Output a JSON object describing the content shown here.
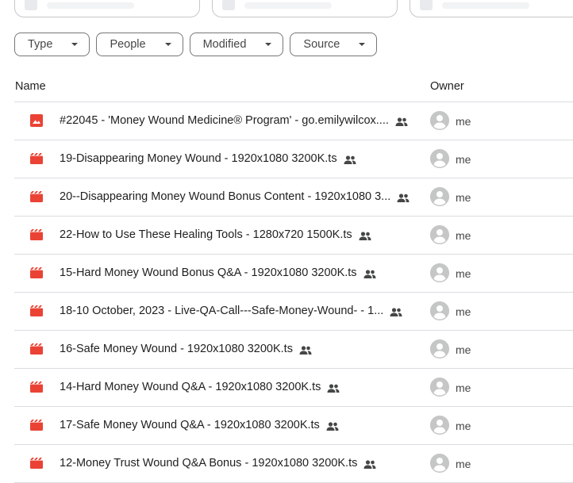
{
  "filters": [
    {
      "label": "Type"
    },
    {
      "label": "People"
    },
    {
      "label": "Modified"
    },
    {
      "label": "Source"
    }
  ],
  "columns": {
    "name": "Name",
    "owner": "Owner"
  },
  "colors": {
    "video_icon": "#ea4335",
    "image_icon": "#ea4335",
    "avatar": "#c4c7c5"
  },
  "files": [
    {
      "name": "#22045 - 'Money Wound Medicine® Program' - go.emilywilcox....",
      "icon": "image-file-icon",
      "shared": true,
      "owner": "me"
    },
    {
      "name": "19-Disappearing Money Wound - 1920x1080 3200K.ts",
      "icon": "video-file-icon",
      "shared": true,
      "owner": "me"
    },
    {
      "name": "20--Disappearing Money Wound Bonus Content - 1920x1080 3...",
      "icon": "video-file-icon",
      "shared": true,
      "owner": "me"
    },
    {
      "name": "22-How to Use These Healing Tools - 1280x720 1500K.ts",
      "icon": "video-file-icon",
      "shared": true,
      "owner": "me"
    },
    {
      "name": "15-Hard Money Wound Bonus Q&A - 1920x1080 3200K.ts",
      "icon": "video-file-icon",
      "shared": true,
      "owner": "me"
    },
    {
      "name": "18-10 October, 2023 - Live-QA-Call---Safe-Money-Wound- - 1...",
      "icon": "video-file-icon",
      "shared": true,
      "owner": "me"
    },
    {
      "name": "16-Safe Money Wound - 1920x1080 3200K.ts",
      "icon": "video-file-icon",
      "shared": true,
      "owner": "me"
    },
    {
      "name": "14-Hard Money Wound Q&A - 1920x1080 3200K.ts",
      "icon": "video-file-icon",
      "shared": true,
      "owner": "me"
    },
    {
      "name": "17-Safe Money Wound Q&A - 1920x1080 3200K.ts",
      "icon": "video-file-icon",
      "shared": true,
      "owner": "me"
    },
    {
      "name": "12-Money Trust Wound Q&A Bonus - 1920x1080 3200K.ts",
      "icon": "video-file-icon",
      "shared": true,
      "owner": "me"
    }
  ]
}
